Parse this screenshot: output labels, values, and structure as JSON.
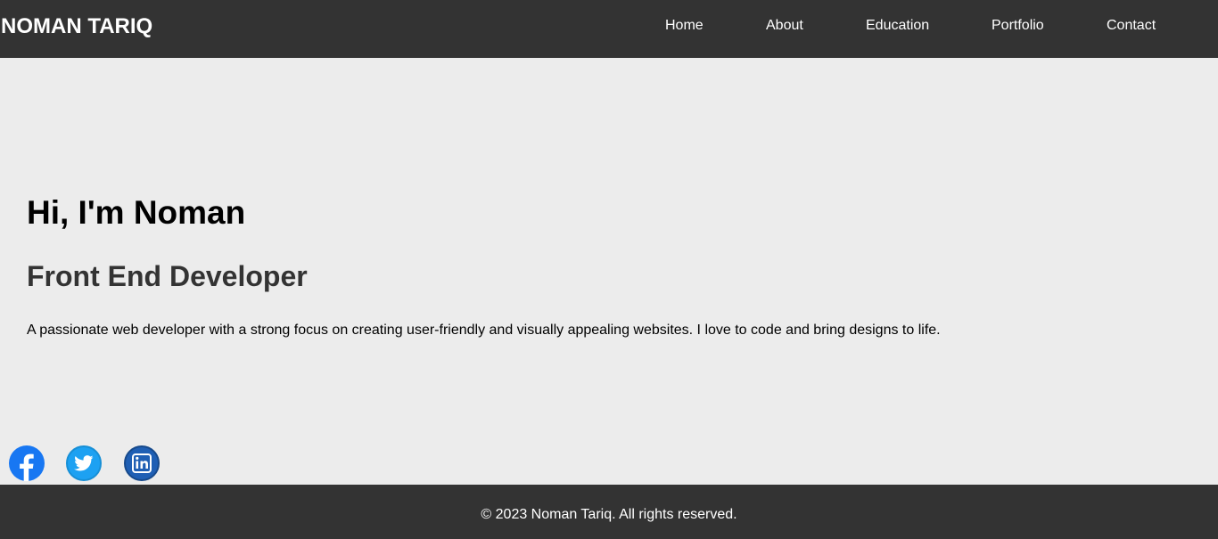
{
  "header": {
    "brand": "NOMAN TARIQ",
    "nav": [
      {
        "label": "Home"
      },
      {
        "label": "About"
      },
      {
        "label": "Education"
      },
      {
        "label": "Portfolio"
      },
      {
        "label": "Contact"
      }
    ]
  },
  "hero": {
    "title": "Hi, I'm Noman",
    "subtitle": "Front End Developer",
    "description": "A passionate web developer with a strong focus on creating user-friendly and visually appealing websites. I love to code and bring designs to life."
  },
  "social": [
    {
      "icon": "facebook-icon",
      "color": "#1877f2"
    },
    {
      "icon": "twitter-icon",
      "color": "#1da1f2"
    },
    {
      "icon": "linkedin-icon",
      "color": "#0a66c2"
    }
  ],
  "footer": {
    "copyright": "© 2023 Noman Tariq. All rights reserved."
  },
  "colors": {
    "header_bg": "#333333",
    "page_bg": "#ececec",
    "footer_bg": "#333333"
  }
}
